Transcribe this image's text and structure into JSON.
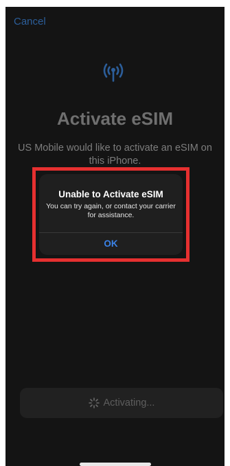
{
  "nav": {
    "cancel_label": "Cancel"
  },
  "header": {
    "title": "Activate eSIM",
    "subtitle": "US Mobile would like to activate an eSIM on this iPhone.",
    "icon": "antenna-signal-icon"
  },
  "alert": {
    "title": "Unable to Activate eSIM",
    "message": "You can try again, or contact your carrier for assistance.",
    "ok_label": "OK"
  },
  "footer": {
    "activating_label": "Activating...",
    "spinner_icon": "spinner-icon"
  },
  "colors": {
    "accent": "#3b82e6",
    "highlight": "#e63030",
    "background": "#141414"
  }
}
